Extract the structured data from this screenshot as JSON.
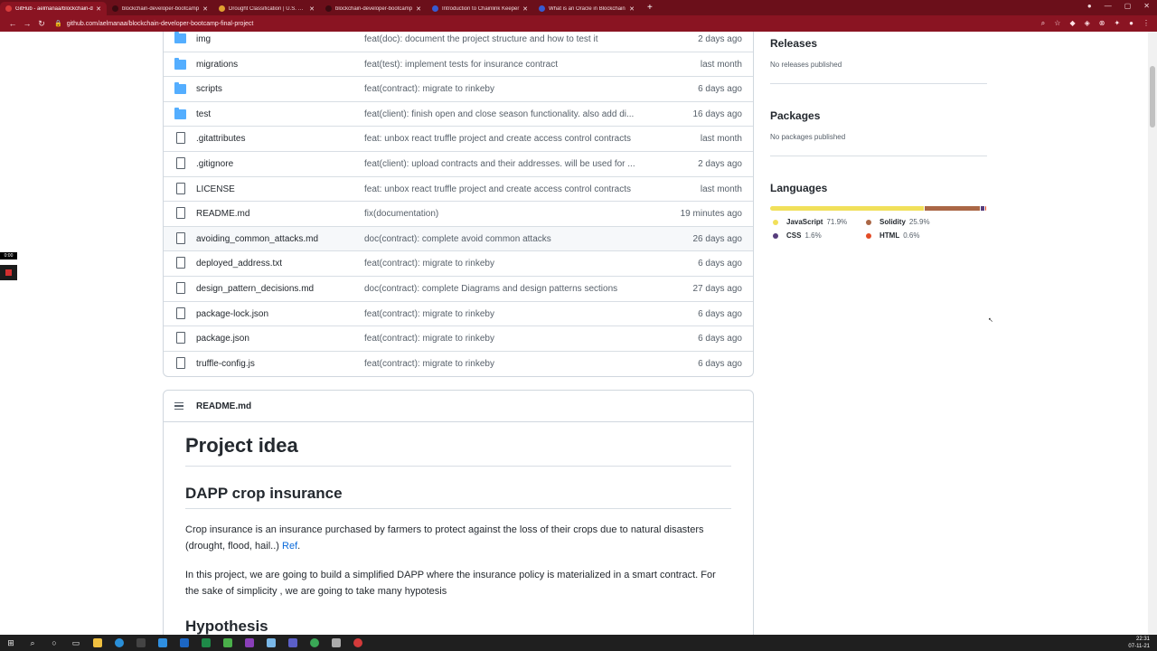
{
  "browser": {
    "tabs": [
      {
        "title": "GitHub - aelmanaa/blockchain-d",
        "active": true,
        "color": "#d63b3b"
      },
      {
        "title": "blockchain-developer-bootcamp",
        "active": false,
        "color": "#3a0a10"
      },
      {
        "title": "Drought Classification | U.S. Dro",
        "active": false,
        "color": "#e0a030"
      },
      {
        "title": "blockchain-developer-bootcamp",
        "active": false,
        "color": "#3a0a10"
      },
      {
        "title": "Introduction to Chainlink Keeper",
        "active": false,
        "color": "#375bd2"
      },
      {
        "title": "What is an Oracle in Blockchain",
        "active": false,
        "color": "#375bd2"
      }
    ],
    "new_tab": "+",
    "url": "github.com/aelmanaa/blockchain-developer-bootcamp-final-project"
  },
  "files": [
    {
      "name": "img",
      "type": "folder",
      "message": "feat(doc): document the project structure and how to test it",
      "age": "2 days ago"
    },
    {
      "name": "migrations",
      "type": "folder",
      "message": "feat(test): implement tests for insurance contract",
      "age": "last month"
    },
    {
      "name": "scripts",
      "type": "folder",
      "message": "feat(contract): migrate to rinkeby",
      "age": "6 days ago"
    },
    {
      "name": "test",
      "type": "folder",
      "message": "feat(client): finish open and close season functionality. also add di...",
      "age": "16 days ago"
    },
    {
      "name": ".gitattributes",
      "type": "file",
      "message": "feat: unbox react truffle project and create access control contracts",
      "age": "last month"
    },
    {
      "name": ".gitignore",
      "type": "file",
      "message": "feat(client): upload contracts and their addresses. will be used for ...",
      "age": "2 days ago"
    },
    {
      "name": "LICENSE",
      "type": "file",
      "message": "feat: unbox react truffle project and create access control contracts",
      "age": "last month"
    },
    {
      "name": "README.md",
      "type": "file",
      "message": "fix(documentation)",
      "age": "19 minutes ago"
    },
    {
      "name": "avoiding_common_attacks.md",
      "type": "file",
      "message": "doc(contract): complete avoid common attacks",
      "age": "26 days ago"
    },
    {
      "name": "deployed_address.txt",
      "type": "file",
      "message": "feat(contract): migrate to rinkeby",
      "age": "6 days ago"
    },
    {
      "name": "design_pattern_decisions.md",
      "type": "file",
      "message": "doc(contract): complete Diagrams and design patterns sections",
      "age": "27 days ago"
    },
    {
      "name": "package-lock.json",
      "type": "file",
      "message": "feat(contract): migrate to rinkeby",
      "age": "6 days ago"
    },
    {
      "name": "package.json",
      "type": "file",
      "message": "feat(contract): migrate to rinkeby",
      "age": "6 days ago"
    },
    {
      "name": "truffle-config.js",
      "type": "file",
      "message": "feat(contract): migrate to rinkeby",
      "age": "6 days ago"
    }
  ],
  "readme": {
    "filename": "README.md",
    "h1": "Project idea",
    "h2": "DAPP crop insurance",
    "p1": "Crop insurance is an insurance purchased by farmers to protect against the loss of their crops due to natural disasters (drought, flood, hail..) ",
    "p1_link": "Ref",
    "p1_end": ".",
    "p2": "In this project, we are going to build a simplified DAPP where the insurance policy is materialized in a smart contract. For the sake of simplicity , we are going to take many hypotesis",
    "h2b": "Hypothesis"
  },
  "sidebar": {
    "releases_title": "Releases",
    "releases_text": "No releases published",
    "packages_title": "Packages",
    "packages_text": "No packages published",
    "languages_title": "Languages",
    "languages": [
      {
        "name": "JavaScript",
        "pct": "71.9%",
        "value": 71.9,
        "color": "#f1e05a"
      },
      {
        "name": "Solidity",
        "pct": "25.9%",
        "value": 25.9,
        "color": "#aa6746"
      },
      {
        "name": "CSS",
        "pct": "1.6%",
        "value": 1.6,
        "color": "#563d7c"
      },
      {
        "name": "HTML",
        "pct": "0.6%",
        "value": 0.6,
        "color": "#e34c26"
      }
    ]
  },
  "recorder": {
    "time": "0:00"
  },
  "clock": {
    "time": "22:31",
    "date": "07-11-21"
  }
}
